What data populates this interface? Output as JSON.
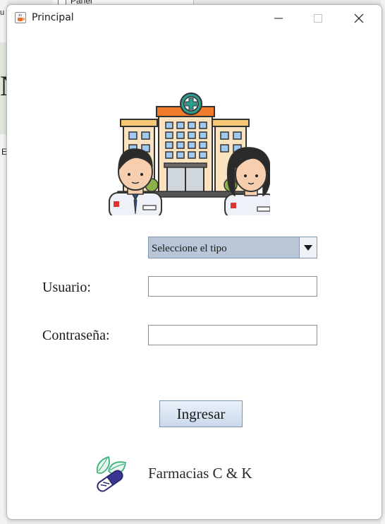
{
  "background": {
    "top_checkbox_label": "Panel",
    "left_fragment_large": "N",
    "left_fragment_small": "E",
    "left_fragment_top": "u"
  },
  "window": {
    "title": "Principal",
    "icon": "java-cup-icon",
    "controls": {
      "minimize": "minimize-icon",
      "maximize": "maximize-icon",
      "close": "close-icon"
    }
  },
  "logo": {
    "icon": "hospital-staff-illustration"
  },
  "form": {
    "tipo_select": {
      "selected": "Seleccione el tipo",
      "icon": "chevron-down-icon"
    },
    "usuario": {
      "label": "Usuario:",
      "value": ""
    },
    "contrasena": {
      "label": "Contraseña:",
      "value": ""
    },
    "submit_label": "Ingresar"
  },
  "footer": {
    "brand_icon": "pill-leaf-icon",
    "brand_name": "Farmacias C & K"
  },
  "colors": {
    "combo_bg": "#b8c6d8",
    "button_bg": "#d6e3f1",
    "hospital_orange": "#f07b2a",
    "hospital_teal": "#2c9c8c"
  }
}
